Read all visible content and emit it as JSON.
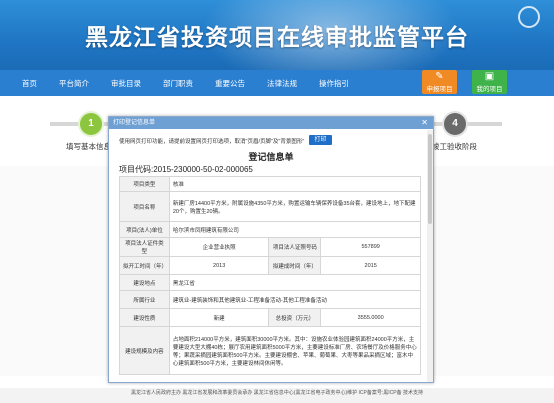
{
  "header": {
    "title": "黑龙江省投资项目在线审批监管平台"
  },
  "nav": {
    "items": [
      "首页",
      "平台简介",
      "审批目录",
      "部门职责",
      "重要公告",
      "法律法规",
      "操作指引"
    ]
  },
  "quick_buttons": {
    "apply": "申报项目",
    "my_projects": "我的项目"
  },
  "steps": {
    "step1_number": "1",
    "step1_label": "填写基本信息",
    "step4_number": "4",
    "step4_label": "竣工验收阶段"
  },
  "dialog": {
    "title": "打印登记信息单",
    "print_tip": "使用网页打印功能，请提前设置网页打印选项，取消\"页眉/页脚\"及\"背景图形\"",
    "print_button": "打印",
    "heading": "登记信息单",
    "project_code": "项目代码:2015-230000-50-02-000065",
    "rows": {
      "project_type_label": "项目类型",
      "project_type": "核准",
      "project_name_label": "项目名称",
      "project_name": "新建厂房14400平方米，附属设施4350平方米，购置运输车辆保养设备35台套，建设地上，地下配建20个，购置生20辆。",
      "unit_label": "项目(法人)单位",
      "unit": "哈尔滨市凤翔建筑有限公司",
      "cert_type_label": "项目法人证件类型",
      "cert_type": "企业营业执照",
      "cert_no_label": "项目法人证照号码",
      "cert_no": "557899",
      "start_year_label": "拟开工时间（年）",
      "start_year": "2013",
      "end_year_label": "拟建成时间（年）",
      "end_year": "2015",
      "location_label": "建设地点",
      "location": "黑龙江省",
      "industry_label": "所属行业",
      "industry": "建筑业-建筑装饰和其他建筑业-工程准备活动-其他工程准备活动",
      "nature_label": "建设性质",
      "nature": "新建",
      "investment_label": "总投资（万元）",
      "investment": "3555.0000",
      "scale_label": "建设规模及内容",
      "scale": "占地面积214000平方米，建筑面积30000平方米。其中：设施农业体验园建筑面积24000平方米，主要建设大型大棚40栋；展厅农用建筑面积5000平方米，主要建设标准厂房、农场餐厅及价格服务中心等；果蔬采摘园建筑面积500平方米。主要建设棚舍、苹果、葡萄果、大枣等果品采摘区域；富木中心建筑面积500平方米，主要建设林间休闲等。"
    }
  },
  "footer": {
    "text": "黑龙江省人民政府主办  黑龙江省发展和改革委员会承办  黑龙江省信息中心(黑龙江省电子政务中心)维护  ICP备案号:黑ICP备 技术支持"
  }
}
